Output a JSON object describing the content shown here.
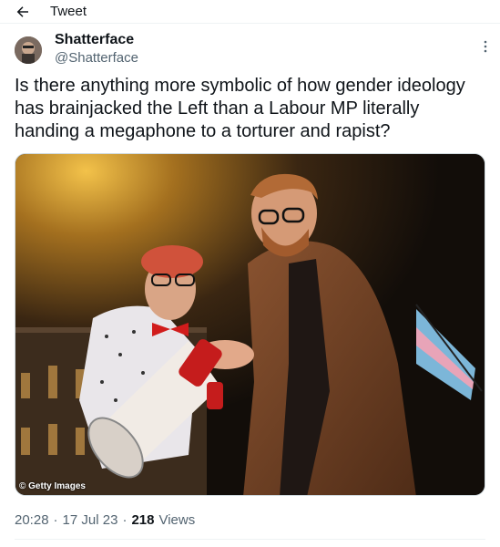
{
  "header": {
    "title": "Tweet",
    "back_icon": "arrow-left-icon"
  },
  "tweet": {
    "author": {
      "display_name": "Shatterface",
      "handle": "@Shatterface"
    },
    "text": "Is there anything more symbolic of how gender ideology has brainjacked the Left than a Labour MP literally handing a megaphone to a torturer and rapist?",
    "media": {
      "credit": "© Getty Images"
    },
    "time": "20:28",
    "date": "17 Jul 23",
    "separator": "·",
    "views_count": "218",
    "views_label": "Views"
  },
  "colors": {
    "text": "#0f1419",
    "secondary": "#536471",
    "border": "#eff3f4"
  }
}
